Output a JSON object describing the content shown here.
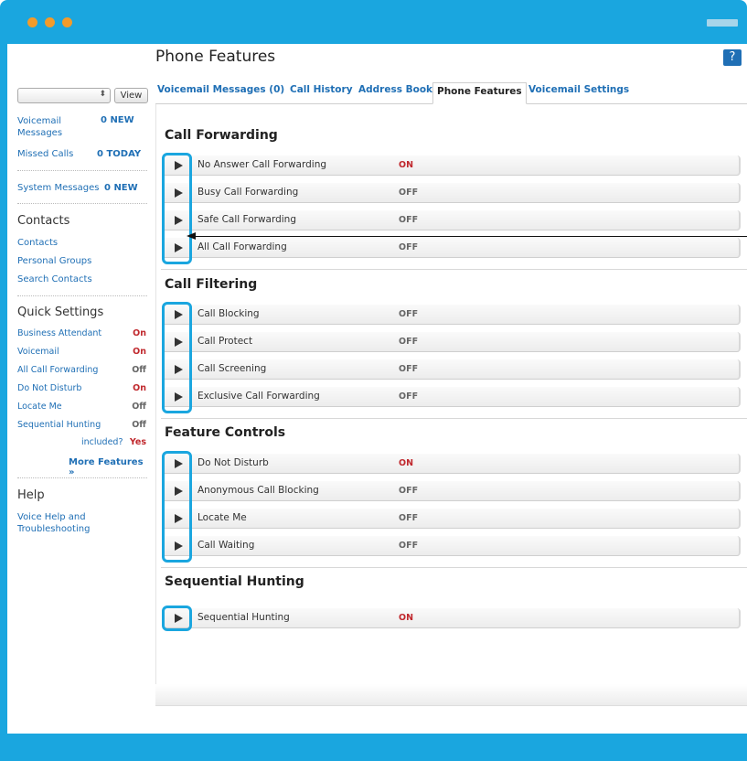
{
  "window": {
    "dot_color": "#f29b2b",
    "frame_color": "#1aa6df"
  },
  "page": {
    "title": "Phone Features",
    "help_label": "?"
  },
  "sidebar": {
    "view_button": "View",
    "select_arrow": "⬍",
    "summary": [
      {
        "label": "Voicemail Messages",
        "value": "0 NEW"
      },
      {
        "label": "Missed Calls",
        "value": "0 TODAY"
      },
      {
        "label": "System Messages",
        "value": "0 NEW"
      }
    ],
    "contacts": {
      "heading": "Contacts",
      "items": [
        "Contacts",
        "Personal Groups",
        "Search Contacts"
      ]
    },
    "quick_settings": {
      "heading": "Quick Settings",
      "items": [
        {
          "label": "Business Attendant",
          "value": "On"
        },
        {
          "label": "Voicemail",
          "value": "On"
        },
        {
          "label": "All Call Forwarding",
          "value": "Off"
        },
        {
          "label": "Do Not Disturb",
          "value": "On"
        },
        {
          "label": "Locate Me",
          "value": "Off"
        },
        {
          "label": "Sequential Hunting",
          "value": "Off"
        }
      ],
      "included_label": "included?",
      "included_value": "Yes",
      "more_features": "More Features »"
    },
    "help": {
      "heading": "Help",
      "link": "Voice Help and Troubleshooting"
    }
  },
  "tabs": [
    {
      "label": "Voicemail Messages (0)",
      "active": false
    },
    {
      "label": "Call History",
      "active": false
    },
    {
      "label": "Address Book",
      "active": false
    },
    {
      "label": "Phone Features",
      "active": true
    },
    {
      "label": "Voicemail Settings",
      "active": false
    }
  ],
  "sections": [
    {
      "title": "Call Forwarding",
      "features": [
        {
          "name": "No Answer Call Forwarding",
          "status": "ON"
        },
        {
          "name": "Busy Call Forwarding",
          "status": "OFF"
        },
        {
          "name": "Safe Call Forwarding",
          "status": "OFF"
        },
        {
          "name": "All Call Forwarding",
          "status": "OFF"
        }
      ]
    },
    {
      "title": "Call Filtering",
      "features": [
        {
          "name": "Call Blocking",
          "status": "OFF"
        },
        {
          "name": "Call Protect",
          "status": "OFF"
        },
        {
          "name": "Call Screening",
          "status": "OFF"
        },
        {
          "name": "Exclusive Call Forwarding",
          "status": "OFF"
        }
      ]
    },
    {
      "title": "Feature Controls",
      "features": [
        {
          "name": "Do Not Disturb",
          "status": "ON"
        },
        {
          "name": "Anonymous Call Blocking",
          "status": "OFF"
        },
        {
          "name": "Locate Me",
          "status": "OFF"
        },
        {
          "name": "Call Waiting",
          "status": "OFF"
        }
      ]
    },
    {
      "title": "Sequential Hunting",
      "features": [
        {
          "name": "Sequential Hunting",
          "status": "ON"
        }
      ]
    }
  ],
  "colors": {
    "on": "#c0282d",
    "off": "#666666",
    "link": "#1f6fb5",
    "highlight": "#1aa6df"
  }
}
